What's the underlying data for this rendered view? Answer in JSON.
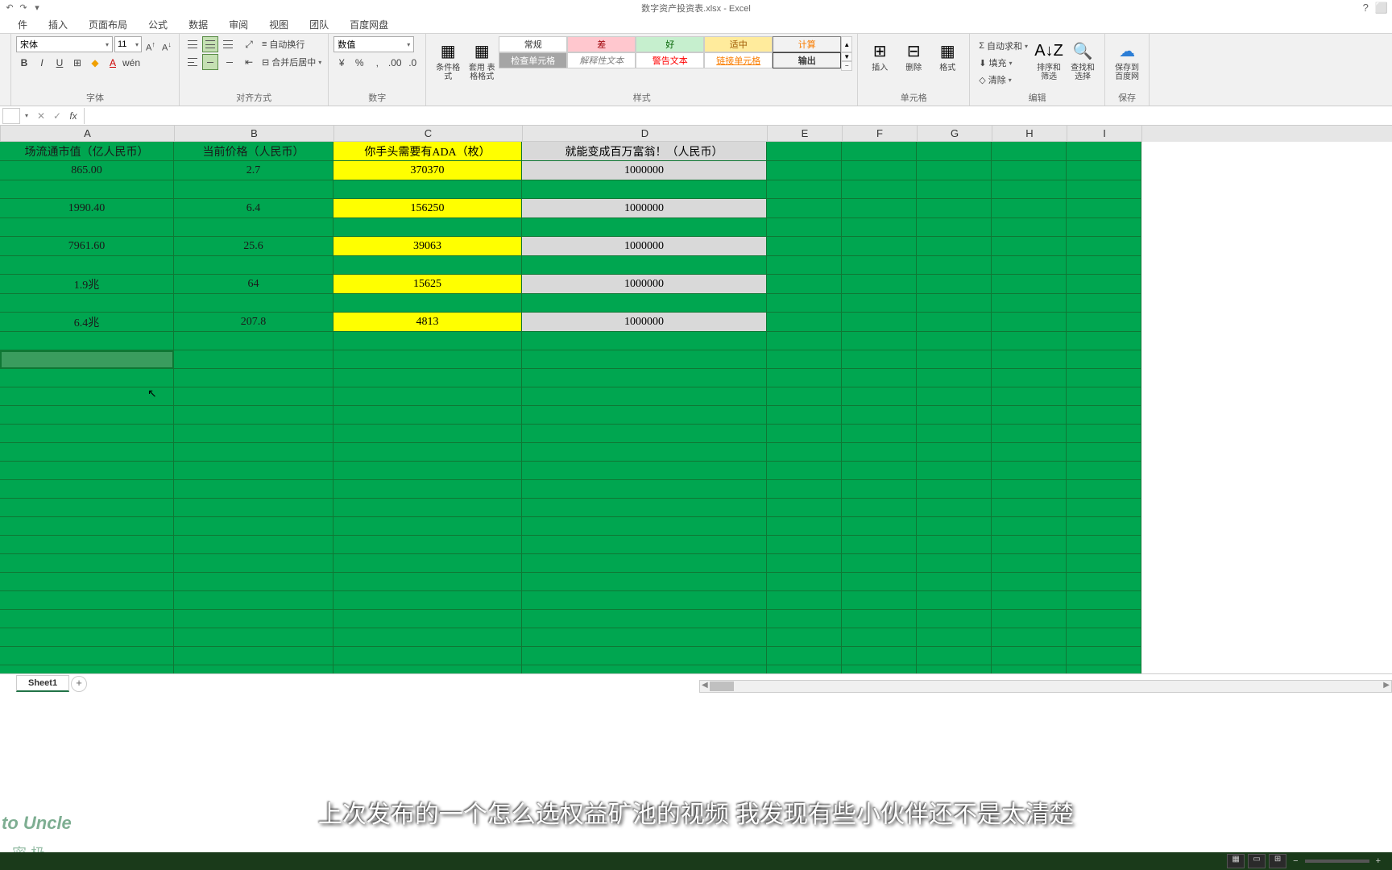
{
  "app": {
    "title": "数字资产投资表.xlsx - Excel",
    "help_icon": "?",
    "window_icon": "⬜"
  },
  "qat": {
    "undo": "↶",
    "redo": "↷",
    "more": "▾"
  },
  "tabs": {
    "file": "件",
    "insert": "插入",
    "page_layout": "页面布局",
    "formulas": "公式",
    "data": "数据",
    "review": "审阅",
    "view": "视图",
    "team": "团队",
    "baidu": "百度网盘"
  },
  "ribbon": {
    "font": {
      "name": "宋体",
      "size": "11",
      "group_label": "字体",
      "bold": "B",
      "italic": "I",
      "underline": "U",
      "border": "⊞",
      "fill": "🪣",
      "font_color": "A",
      "grow": "A↑",
      "shrink": "A↓"
    },
    "align": {
      "group_label": "对齐方式",
      "wrap": "自动换行",
      "merge": "合并后居中",
      "wrap_icon": "≡",
      "merge_icon": "⊟"
    },
    "number": {
      "format": "数值",
      "group_label": "数字",
      "currency": "¥",
      "percent": "%",
      "comma": ",",
      "inc_dec": "←0",
      "dec_dec": "0→"
    },
    "styles": {
      "cond_fmt": "条件格式",
      "table_fmt": "套用\n表格格式",
      "normal": "常规",
      "bad": "差",
      "good": "好",
      "neutral": "适中",
      "calc": "计算",
      "check": "检查单元格",
      "explain": "解释性文本",
      "warn": "警告文本",
      "link": "链接单元格",
      "output": "输出",
      "group_label": "样式"
    },
    "cells": {
      "insert": "插入",
      "delete": "删除",
      "format": "格式",
      "group_label": "单元格"
    },
    "editing": {
      "autosum": "自动求和",
      "fill": "填充",
      "clear": "清除",
      "sort": "排序和筛选",
      "find": "查找和选择",
      "group_label": "编辑",
      "sum_icon": "Σ",
      "fill_icon": "⬇",
      "clear_icon": "◇"
    },
    "save": {
      "save_baidu": "保存到\n百度网",
      "group_label": "保存"
    }
  },
  "formula_bar": {
    "name_box": "",
    "cancel": "✕",
    "confirm": "✓",
    "fx": "fx",
    "value": ""
  },
  "columns": [
    "A",
    "B",
    "C",
    "D",
    "E",
    "F",
    "G",
    "H",
    "I"
  ],
  "table": {
    "headers": {
      "A": "场流通市值（亿人民币）",
      "B": "当前价格（人民币）",
      "C": "你手头需要有ADA（枚）",
      "D": "就能变成百万富翁！（人民币）"
    },
    "rows": [
      {
        "A": "865.00",
        "B": "2.7",
        "C": "370370",
        "D": "1000000"
      },
      {
        "A": "1990.40",
        "B": "6.4",
        "C": "156250",
        "D": "1000000"
      },
      {
        "A": "7961.60",
        "B": "25.6",
        "C": "39063",
        "D": "1000000"
      },
      {
        "A": "1.9兆",
        "B": "64",
        "C": "15625",
        "D": "1000000"
      },
      {
        "A": "6.4兆",
        "B": "207.8",
        "C": "4813",
        "D": "1000000"
      }
    ]
  },
  "sheets": {
    "active": "Sheet1",
    "add": "+"
  },
  "subtitle": "上次发布的一个怎么选权益矿池的视频 我发现有些小伙伴还不是太清楚",
  "watermark": "to Uncle",
  "watermark2": "密    极"
}
